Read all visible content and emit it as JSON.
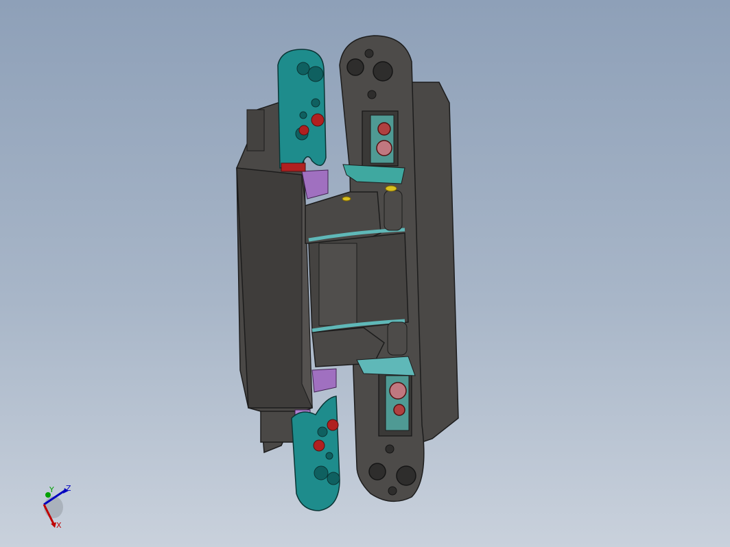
{
  "viewport": {
    "background_top": "#8ea0b8",
    "background_bottom": "#c9d1dc"
  },
  "model": {
    "colors": {
      "body": "#4a4846",
      "body_edge": "#1c1c1c",
      "teal_part": "#1e8c8c",
      "cyan_detail": "#5fb8b8",
      "purple_part": "#a070c0",
      "red_screw": "#b02020",
      "pink_screw": "#c07880",
      "yellow_pin": "#d8c020"
    }
  },
  "triad": {
    "x_label": "X",
    "y_label": "Y",
    "z_label": "Z",
    "x_color": "#c00000",
    "y_color": "#00a000",
    "z_color": "#0000c0"
  }
}
